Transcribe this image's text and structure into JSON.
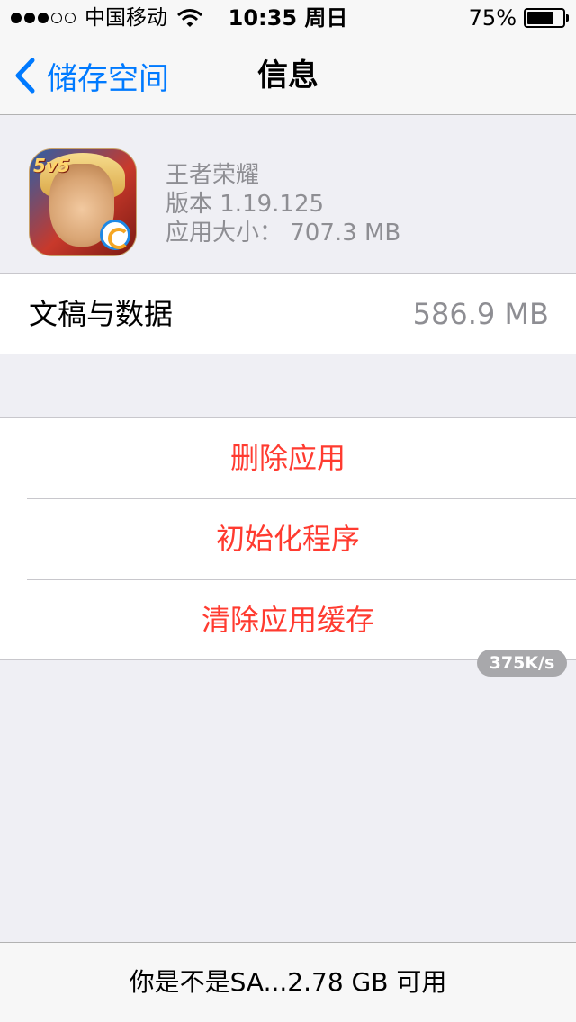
{
  "status_bar": {
    "carrier": "中国移动",
    "time": "10:35 周日",
    "battery_percent_text": "75%",
    "battery_level": 0.75,
    "signal_bars_filled": 3,
    "signal_bars_total": 5
  },
  "nav": {
    "back_label": "储存空间",
    "title": "信息"
  },
  "app": {
    "name": "王者荣耀",
    "version": "版本 1.19.125",
    "size": "应用大小： 707.3 MB",
    "icon_badge": "5v5"
  },
  "documents": {
    "label": "文稿与数据",
    "value": "586.9 MB"
  },
  "actions": {
    "delete": "删除应用",
    "reset": "初始化程序",
    "clear_cache": "清除应用缓存"
  },
  "speed_badge": "375K/s",
  "footer": {
    "text": "你是不是SA...2.78 GB 可用"
  },
  "colors": {
    "accent": "#007aff",
    "destructive": "#ff3b30",
    "secondary_text": "#8e8e93",
    "background": "#efeff4"
  }
}
